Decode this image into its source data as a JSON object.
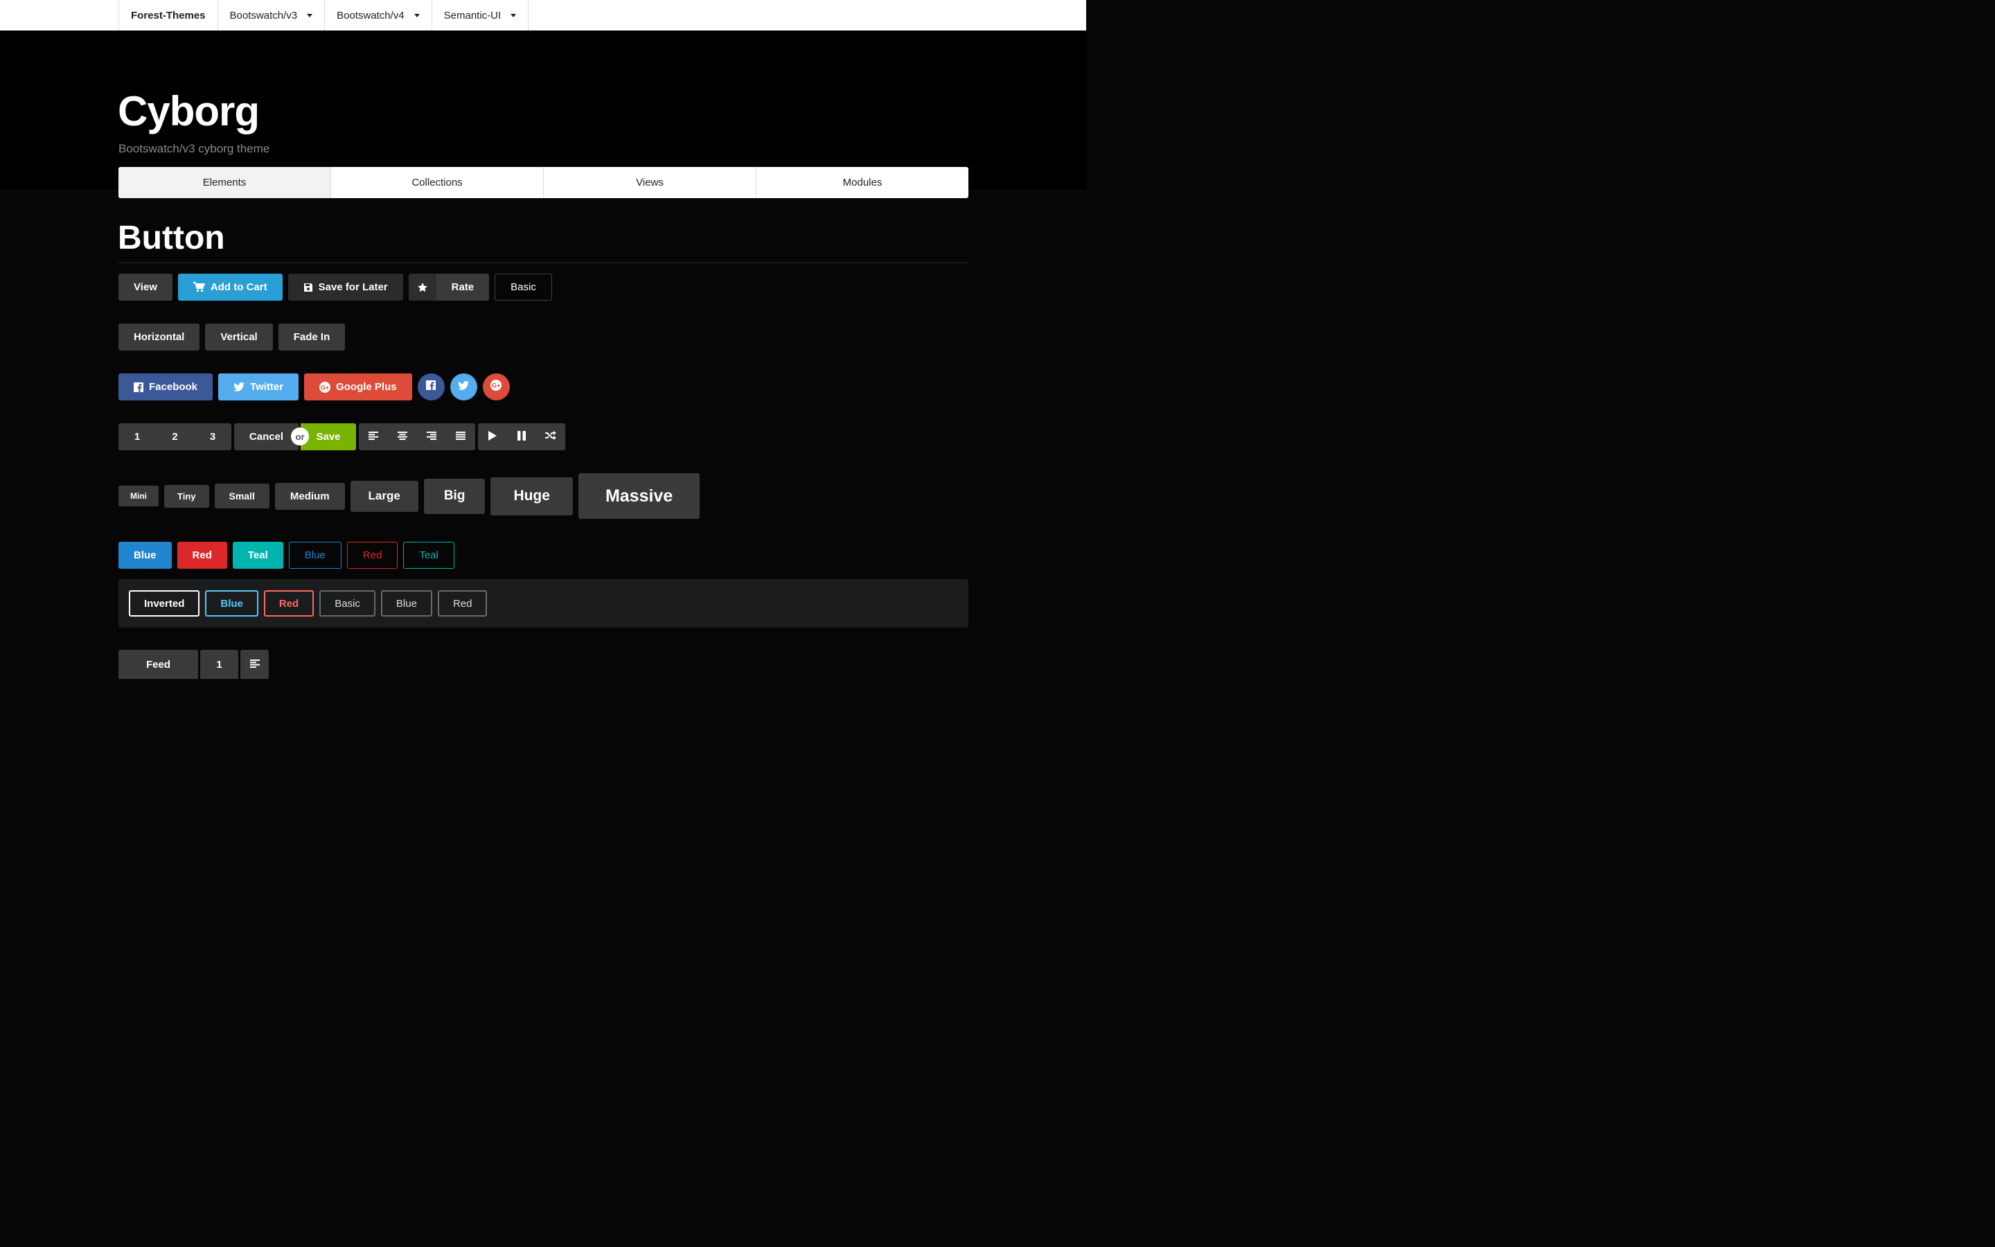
{
  "topbar": {
    "brand": "Forest-Themes",
    "menus": [
      "Bootswatch/v3",
      "Bootswatch/v4",
      "Semantic-UI"
    ]
  },
  "header": {
    "title": "Cyborg",
    "subtitle": "Bootswatch/v3 cyborg theme",
    "tabs": [
      "Elements",
      "Collections",
      "Views",
      "Modules"
    ],
    "active_tab": "Elements"
  },
  "section": {
    "title": "Button"
  },
  "row1": {
    "view": "View",
    "add_to_cart": "Add to Cart",
    "save_later": "Save for Later",
    "rate": "Rate",
    "basic": "Basic"
  },
  "row2": {
    "horizontal": "Horizontal",
    "vertical": "Vertical",
    "fade_in": "Fade In"
  },
  "row3": {
    "facebook": "Facebook",
    "twitter": "Twitter",
    "google_plus": "Google Plus"
  },
  "row4": {
    "n1": "1",
    "n2": "2",
    "n3": "3",
    "cancel": "Cancel",
    "or": "or",
    "save": "Save"
  },
  "sizes": {
    "mini": "Mini",
    "tiny": "Tiny",
    "small": "Small",
    "medium": "Medium",
    "large": "Large",
    "big": "Big",
    "huge": "Huge",
    "massive": "Massive"
  },
  "colors": {
    "blue": "Blue",
    "red": "Red",
    "teal": "Teal",
    "blue_hex": "#2185d0",
    "red_hex": "#db2828",
    "teal_hex": "#00b5ad",
    "save_hex": "#77b300"
  },
  "inverted": {
    "inverted": "Inverted",
    "blue": "Blue",
    "red": "Red",
    "basic": "Basic",
    "basic_blue": "Blue",
    "basic_red": "Red"
  },
  "feed": {
    "label": "Feed",
    "count": "1"
  }
}
